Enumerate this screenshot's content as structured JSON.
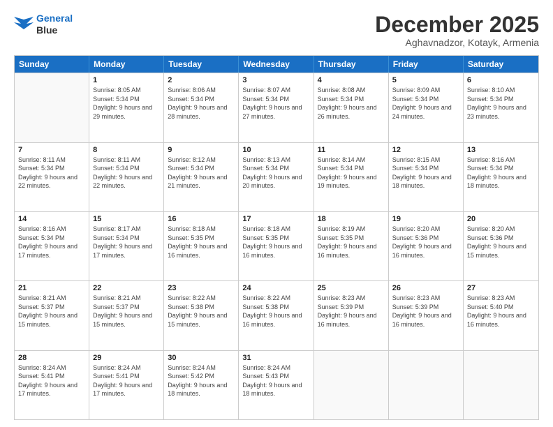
{
  "header": {
    "logo_line1": "General",
    "logo_line2": "Blue",
    "month_title": "December 2025",
    "location": "Aghavnadzor, Kotayk, Armenia"
  },
  "days_of_week": [
    "Sunday",
    "Monday",
    "Tuesday",
    "Wednesday",
    "Thursday",
    "Friday",
    "Saturday"
  ],
  "rows": [
    [
      {
        "day": "",
        "empty": true
      },
      {
        "day": "1",
        "sunrise": "8:05 AM",
        "sunset": "5:34 PM",
        "daylight": "9 hours and 29 minutes."
      },
      {
        "day": "2",
        "sunrise": "8:06 AM",
        "sunset": "5:34 PM",
        "daylight": "9 hours and 28 minutes."
      },
      {
        "day": "3",
        "sunrise": "8:07 AM",
        "sunset": "5:34 PM",
        "daylight": "9 hours and 27 minutes."
      },
      {
        "day": "4",
        "sunrise": "8:08 AM",
        "sunset": "5:34 PM",
        "daylight": "9 hours and 26 minutes."
      },
      {
        "day": "5",
        "sunrise": "8:09 AM",
        "sunset": "5:34 PM",
        "daylight": "9 hours and 24 minutes."
      },
      {
        "day": "6",
        "sunrise": "8:10 AM",
        "sunset": "5:34 PM",
        "daylight": "9 hours and 23 minutes."
      }
    ],
    [
      {
        "day": "7",
        "sunrise": "8:11 AM",
        "sunset": "5:34 PM",
        "daylight": "9 hours and 22 minutes."
      },
      {
        "day": "8",
        "sunrise": "8:11 AM",
        "sunset": "5:34 PM",
        "daylight": "9 hours and 22 minutes."
      },
      {
        "day": "9",
        "sunrise": "8:12 AM",
        "sunset": "5:34 PM",
        "daylight": "9 hours and 21 minutes."
      },
      {
        "day": "10",
        "sunrise": "8:13 AM",
        "sunset": "5:34 PM",
        "daylight": "9 hours and 20 minutes."
      },
      {
        "day": "11",
        "sunrise": "8:14 AM",
        "sunset": "5:34 PM",
        "daylight": "9 hours and 19 minutes."
      },
      {
        "day": "12",
        "sunrise": "8:15 AM",
        "sunset": "5:34 PM",
        "daylight": "9 hours and 18 minutes."
      },
      {
        "day": "13",
        "sunrise": "8:16 AM",
        "sunset": "5:34 PM",
        "daylight": "9 hours and 18 minutes."
      }
    ],
    [
      {
        "day": "14",
        "sunrise": "8:16 AM",
        "sunset": "5:34 PM",
        "daylight": "9 hours and 17 minutes."
      },
      {
        "day": "15",
        "sunrise": "8:17 AM",
        "sunset": "5:34 PM",
        "daylight": "9 hours and 17 minutes."
      },
      {
        "day": "16",
        "sunrise": "8:18 AM",
        "sunset": "5:35 PM",
        "daylight": "9 hours and 16 minutes."
      },
      {
        "day": "17",
        "sunrise": "8:18 AM",
        "sunset": "5:35 PM",
        "daylight": "9 hours and 16 minutes."
      },
      {
        "day": "18",
        "sunrise": "8:19 AM",
        "sunset": "5:35 PM",
        "daylight": "9 hours and 16 minutes."
      },
      {
        "day": "19",
        "sunrise": "8:20 AM",
        "sunset": "5:36 PM",
        "daylight": "9 hours and 16 minutes."
      },
      {
        "day": "20",
        "sunrise": "8:20 AM",
        "sunset": "5:36 PM",
        "daylight": "9 hours and 15 minutes."
      }
    ],
    [
      {
        "day": "21",
        "sunrise": "8:21 AM",
        "sunset": "5:37 PM",
        "daylight": "9 hours and 15 minutes."
      },
      {
        "day": "22",
        "sunrise": "8:21 AM",
        "sunset": "5:37 PM",
        "daylight": "9 hours and 15 minutes."
      },
      {
        "day": "23",
        "sunrise": "8:22 AM",
        "sunset": "5:38 PM",
        "daylight": "9 hours and 15 minutes."
      },
      {
        "day": "24",
        "sunrise": "8:22 AM",
        "sunset": "5:38 PM",
        "daylight": "9 hours and 16 minutes."
      },
      {
        "day": "25",
        "sunrise": "8:23 AM",
        "sunset": "5:39 PM",
        "daylight": "9 hours and 16 minutes."
      },
      {
        "day": "26",
        "sunrise": "8:23 AM",
        "sunset": "5:39 PM",
        "daylight": "9 hours and 16 minutes."
      },
      {
        "day": "27",
        "sunrise": "8:23 AM",
        "sunset": "5:40 PM",
        "daylight": "9 hours and 16 minutes."
      }
    ],
    [
      {
        "day": "28",
        "sunrise": "8:24 AM",
        "sunset": "5:41 PM",
        "daylight": "9 hours and 17 minutes."
      },
      {
        "day": "29",
        "sunrise": "8:24 AM",
        "sunset": "5:41 PM",
        "daylight": "9 hours and 17 minutes."
      },
      {
        "day": "30",
        "sunrise": "8:24 AM",
        "sunset": "5:42 PM",
        "daylight": "9 hours and 18 minutes."
      },
      {
        "day": "31",
        "sunrise": "8:24 AM",
        "sunset": "5:43 PM",
        "daylight": "9 hours and 18 minutes."
      },
      {
        "day": "",
        "empty": true
      },
      {
        "day": "",
        "empty": true
      },
      {
        "day": "",
        "empty": true
      }
    ]
  ],
  "labels": {
    "sunrise": "Sunrise:",
    "sunset": "Sunset:",
    "daylight": "Daylight:"
  }
}
